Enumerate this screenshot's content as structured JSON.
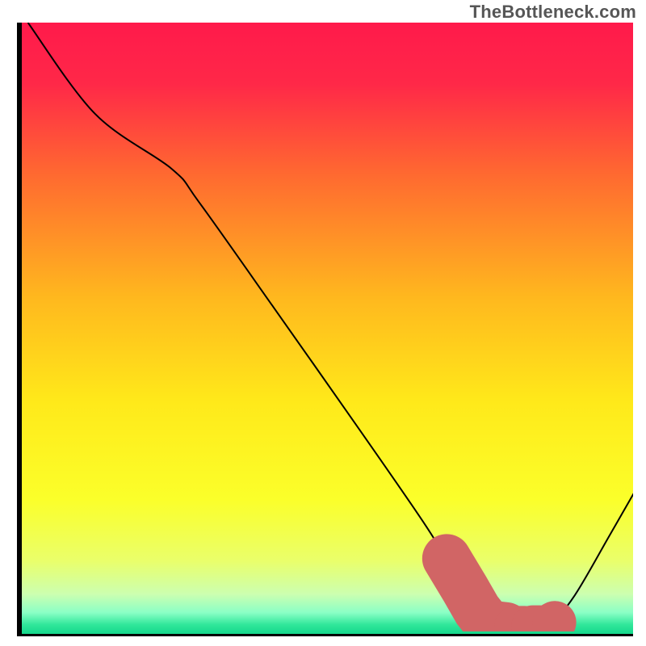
{
  "attribution": "TheBottleneck.com",
  "chart_data": {
    "type": "line",
    "title": "",
    "xlabel": "",
    "ylabel": "",
    "xlim": [
      0,
      100
    ],
    "ylim": [
      0,
      100
    ],
    "grid": false,
    "background_gradient_stops": [
      {
        "offset": 0.0,
        "color": "#ff1a4b"
      },
      {
        "offset": 0.1,
        "color": "#ff2848"
      },
      {
        "offset": 0.25,
        "color": "#ff6a30"
      },
      {
        "offset": 0.45,
        "color": "#ffb81e"
      },
      {
        "offset": 0.62,
        "color": "#ffe91a"
      },
      {
        "offset": 0.78,
        "color": "#fbff2a"
      },
      {
        "offset": 0.88,
        "color": "#eaff6a"
      },
      {
        "offset": 0.935,
        "color": "#ccffb0"
      },
      {
        "offset": 0.965,
        "color": "#8bffc6"
      },
      {
        "offset": 0.985,
        "color": "#30e79a"
      },
      {
        "offset": 1.0,
        "color": "#15d88c"
      }
    ],
    "curve_points": [
      {
        "x": 1.0,
        "y": 100.0
      },
      {
        "x": 12.0,
        "y": 85.0
      },
      {
        "x": 24.5,
        "y": 76.0
      },
      {
        "x": 29.0,
        "y": 70.5
      },
      {
        "x": 41.0,
        "y": 53.5
      },
      {
        "x": 55.0,
        "y": 33.5
      },
      {
        "x": 66.0,
        "y": 17.5
      },
      {
        "x": 71.5,
        "y": 8.5
      },
      {
        "x": 75.0,
        "y": 3.0
      },
      {
        "x": 77.0,
        "y": 1.0
      },
      {
        "x": 80.0,
        "y": 0.6
      },
      {
        "x": 84.0,
        "y": 0.6
      },
      {
        "x": 86.5,
        "y": 1.2
      },
      {
        "x": 90.5,
        "y": 6.0
      },
      {
        "x": 96.0,
        "y": 15.5
      },
      {
        "x": 100.0,
        "y": 22.5
      }
    ],
    "highlight_segments": [
      {
        "color": "#d16565",
        "width": 8,
        "points": [
          {
            "x": 69.5,
            "y": 12.0
          },
          {
            "x": 72.5,
            "y": 7.0
          },
          {
            "x": 74.5,
            "y": 3.5
          },
          {
            "x": 76.0,
            "y": 1.6
          },
          {
            "x": 77.5,
            "y": 1.0
          },
          {
            "x": 79.2,
            "y": 0.8
          }
        ]
      },
      {
        "color": "#d16565",
        "width": 7,
        "points": [
          {
            "x": 80.8,
            "y": 0.7
          },
          {
            "x": 82.2,
            "y": 0.7
          }
        ]
      },
      {
        "color": "#d16565",
        "width": 7,
        "points": [
          {
            "x": 83.6,
            "y": 0.8
          },
          {
            "x": 84.8,
            "y": 0.8
          }
        ]
      },
      {
        "color": "#d16565",
        "width": 7,
        "points": [
          {
            "x": 87.0,
            "y": 1.4
          },
          {
            "x": 87.2,
            "y": 1.5
          }
        ]
      }
    ]
  }
}
